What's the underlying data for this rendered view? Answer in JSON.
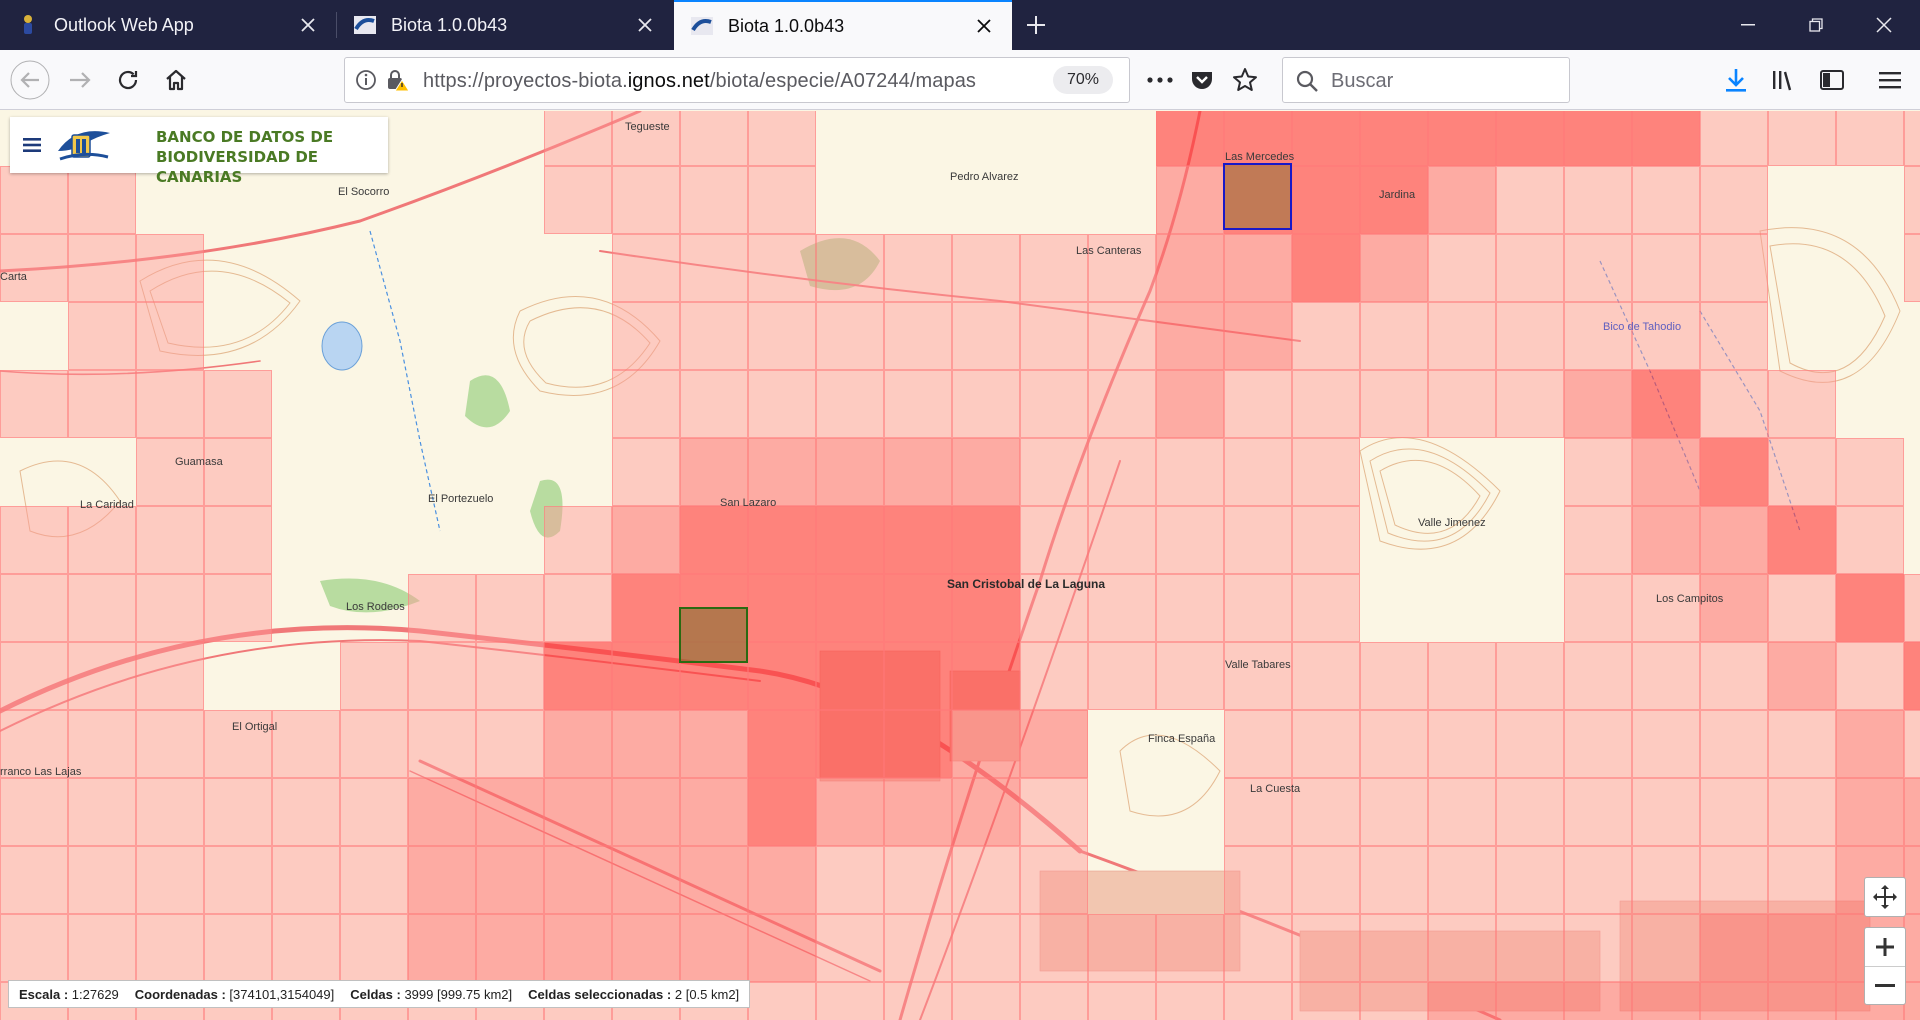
{
  "browser": {
    "tabs": [
      {
        "title": "Outlook Web App",
        "active": false
      },
      {
        "title": "Biota 1.0.0b43",
        "active": false
      },
      {
        "title": "Biota 1.0.0b43",
        "active": true
      }
    ],
    "url": {
      "prefix": "https://proyectos-biota.",
      "domain": "ignos.net",
      "path": "/biota/especie/A07244/mapas"
    },
    "zoom": "70%",
    "search_placeholder": "Buscar"
  },
  "brand": {
    "line1": "BANCO DE DATOS DE",
    "line2": "BIODIVERSIDAD DE CANARIAS"
  },
  "places": [
    "Tegueste",
    "Pedro Alvarez",
    "Las Mercedes",
    "Jardina",
    "El Socorro",
    "Las Canteras",
    "Bico de Tahodio",
    "Guamasa",
    "La Caridad",
    "El Portezuelo",
    "San Lazaro",
    "San Cristobal de La Laguna",
    "Los Rodeos",
    "Valle Jimenez",
    "Los Campitos",
    "Valle Tabares",
    "El Ortigal",
    "Finca España",
    "La Cuesta",
    "rranco Las Lajas",
    "Carta"
  ],
  "status": {
    "scale_label": "Escala :",
    "scale_value": "1:27629",
    "coords_label": "Coordenadas :",
    "coords_value": "[374101,3154049]",
    "cells_label": "Celdas :",
    "cells_value": "3999 [999.75 km2]",
    "selected_label": "Celdas seleccionadas :",
    "selected_value": "2 [0.5 km2]"
  },
  "colors": {
    "tabstrip": "#202340",
    "accent": "#0a84ff",
    "brand_green": "#4a7a24",
    "cell_light": "#ffb0b0",
    "cell_mid": "#ff8080",
    "cell_dark": "#ff4040"
  }
}
